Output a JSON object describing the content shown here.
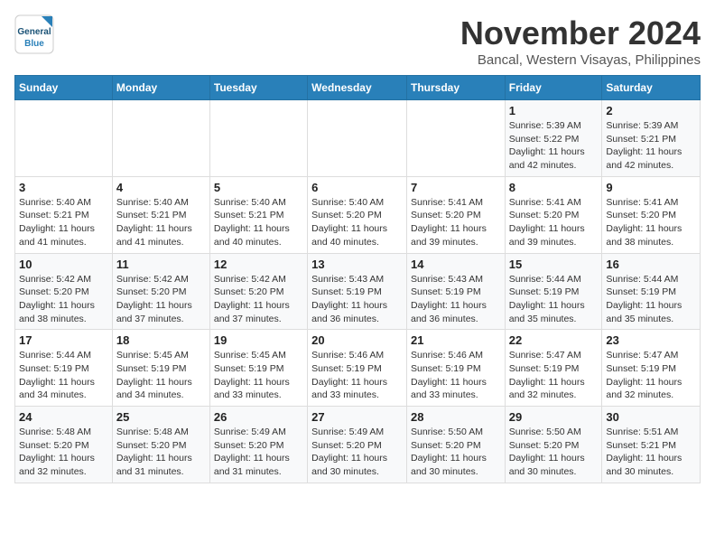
{
  "logo": {
    "line1": "General",
    "line2": "Blue"
  },
  "title": "November 2024",
  "location": "Bancal, Western Visayas, Philippines",
  "weekdays": [
    "Sunday",
    "Monday",
    "Tuesday",
    "Wednesday",
    "Thursday",
    "Friday",
    "Saturday"
  ],
  "weeks": [
    [
      {
        "day": "",
        "info": ""
      },
      {
        "day": "",
        "info": ""
      },
      {
        "day": "",
        "info": ""
      },
      {
        "day": "",
        "info": ""
      },
      {
        "day": "",
        "info": ""
      },
      {
        "day": "1",
        "info": "Sunrise: 5:39 AM\nSunset: 5:22 PM\nDaylight: 11 hours and 42 minutes."
      },
      {
        "day": "2",
        "info": "Sunrise: 5:39 AM\nSunset: 5:21 PM\nDaylight: 11 hours and 42 minutes."
      }
    ],
    [
      {
        "day": "3",
        "info": "Sunrise: 5:40 AM\nSunset: 5:21 PM\nDaylight: 11 hours and 41 minutes."
      },
      {
        "day": "4",
        "info": "Sunrise: 5:40 AM\nSunset: 5:21 PM\nDaylight: 11 hours and 41 minutes."
      },
      {
        "day": "5",
        "info": "Sunrise: 5:40 AM\nSunset: 5:21 PM\nDaylight: 11 hours and 40 minutes."
      },
      {
        "day": "6",
        "info": "Sunrise: 5:40 AM\nSunset: 5:20 PM\nDaylight: 11 hours and 40 minutes."
      },
      {
        "day": "7",
        "info": "Sunrise: 5:41 AM\nSunset: 5:20 PM\nDaylight: 11 hours and 39 minutes."
      },
      {
        "day": "8",
        "info": "Sunrise: 5:41 AM\nSunset: 5:20 PM\nDaylight: 11 hours and 39 minutes."
      },
      {
        "day": "9",
        "info": "Sunrise: 5:41 AM\nSunset: 5:20 PM\nDaylight: 11 hours and 38 minutes."
      }
    ],
    [
      {
        "day": "10",
        "info": "Sunrise: 5:42 AM\nSunset: 5:20 PM\nDaylight: 11 hours and 38 minutes."
      },
      {
        "day": "11",
        "info": "Sunrise: 5:42 AM\nSunset: 5:20 PM\nDaylight: 11 hours and 37 minutes."
      },
      {
        "day": "12",
        "info": "Sunrise: 5:42 AM\nSunset: 5:20 PM\nDaylight: 11 hours and 37 minutes."
      },
      {
        "day": "13",
        "info": "Sunrise: 5:43 AM\nSunset: 5:19 PM\nDaylight: 11 hours and 36 minutes."
      },
      {
        "day": "14",
        "info": "Sunrise: 5:43 AM\nSunset: 5:19 PM\nDaylight: 11 hours and 36 minutes."
      },
      {
        "day": "15",
        "info": "Sunrise: 5:44 AM\nSunset: 5:19 PM\nDaylight: 11 hours and 35 minutes."
      },
      {
        "day": "16",
        "info": "Sunrise: 5:44 AM\nSunset: 5:19 PM\nDaylight: 11 hours and 35 minutes."
      }
    ],
    [
      {
        "day": "17",
        "info": "Sunrise: 5:44 AM\nSunset: 5:19 PM\nDaylight: 11 hours and 34 minutes."
      },
      {
        "day": "18",
        "info": "Sunrise: 5:45 AM\nSunset: 5:19 PM\nDaylight: 11 hours and 34 minutes."
      },
      {
        "day": "19",
        "info": "Sunrise: 5:45 AM\nSunset: 5:19 PM\nDaylight: 11 hours and 33 minutes."
      },
      {
        "day": "20",
        "info": "Sunrise: 5:46 AM\nSunset: 5:19 PM\nDaylight: 11 hours and 33 minutes."
      },
      {
        "day": "21",
        "info": "Sunrise: 5:46 AM\nSunset: 5:19 PM\nDaylight: 11 hours and 33 minutes."
      },
      {
        "day": "22",
        "info": "Sunrise: 5:47 AM\nSunset: 5:19 PM\nDaylight: 11 hours and 32 minutes."
      },
      {
        "day": "23",
        "info": "Sunrise: 5:47 AM\nSunset: 5:19 PM\nDaylight: 11 hours and 32 minutes."
      }
    ],
    [
      {
        "day": "24",
        "info": "Sunrise: 5:48 AM\nSunset: 5:20 PM\nDaylight: 11 hours and 32 minutes."
      },
      {
        "day": "25",
        "info": "Sunrise: 5:48 AM\nSunset: 5:20 PM\nDaylight: 11 hours and 31 minutes."
      },
      {
        "day": "26",
        "info": "Sunrise: 5:49 AM\nSunset: 5:20 PM\nDaylight: 11 hours and 31 minutes."
      },
      {
        "day": "27",
        "info": "Sunrise: 5:49 AM\nSunset: 5:20 PM\nDaylight: 11 hours and 30 minutes."
      },
      {
        "day": "28",
        "info": "Sunrise: 5:50 AM\nSunset: 5:20 PM\nDaylight: 11 hours and 30 minutes."
      },
      {
        "day": "29",
        "info": "Sunrise: 5:50 AM\nSunset: 5:20 PM\nDaylight: 11 hours and 30 minutes."
      },
      {
        "day": "30",
        "info": "Sunrise: 5:51 AM\nSunset: 5:21 PM\nDaylight: 11 hours and 30 minutes."
      }
    ]
  ]
}
